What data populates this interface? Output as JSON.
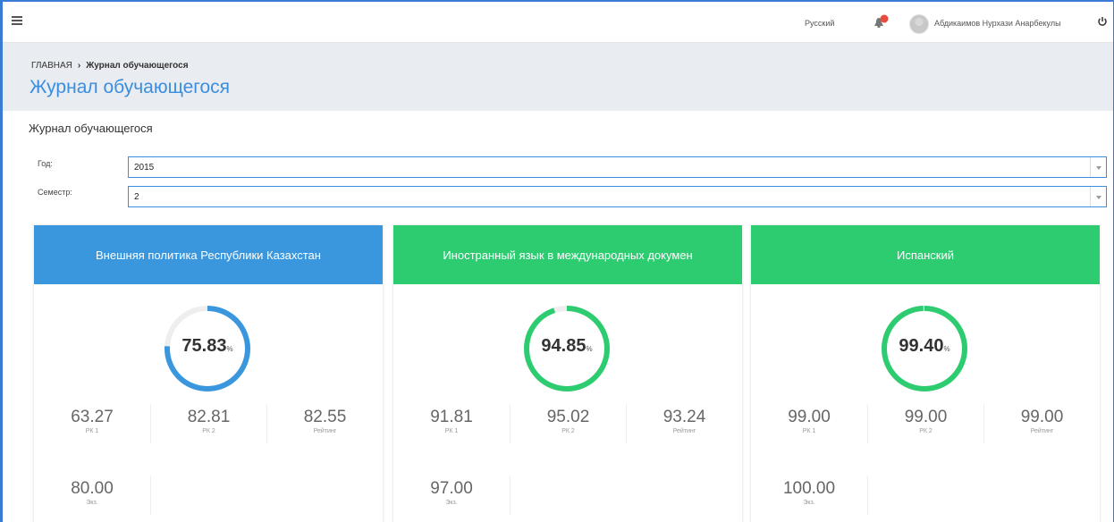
{
  "header": {
    "language": "Русский",
    "user_name": "Абдикаимов Нурхази Анарбекулы"
  },
  "breadcrumb": {
    "home": "ГЛАВНАЯ",
    "separator": "›",
    "current": "Журнал обучающегося"
  },
  "page_title": "Журнал обучающегося",
  "section_title": "Журнал обучающегося",
  "filters": {
    "year_label": "Год:",
    "year_value": "2015",
    "semester_label": "Семестр:",
    "semester_value": "2"
  },
  "colors": {
    "blue": "#3a97dd",
    "green": "#2ecc71"
  },
  "cards": [
    {
      "title": "Внешняя политика Республики Казахстан",
      "color": "blue",
      "score": "75.83",
      "score_fraction": 0.7583,
      "pct": "%",
      "rk1_value": "63.27",
      "rk1_label": "РК 1",
      "rk2_value": "82.81",
      "rk2_label": "РК 2",
      "rating_value": "82.55",
      "rating_label": "Рейтинг",
      "exam_value": "80.00",
      "exam_label": "Экз."
    },
    {
      "title": "Иностранный язык в международных докумен",
      "color": "green",
      "score": "94.85",
      "score_fraction": 0.9485,
      "pct": "%",
      "rk1_value": "91.81",
      "rk1_label": "РК 1",
      "rk2_value": "95.02",
      "rk2_label": "РК 2",
      "rating_value": "93.24",
      "rating_label": "Рейтинг",
      "exam_value": "97.00",
      "exam_label": "Экз."
    },
    {
      "title": "Испанский",
      "color": "green",
      "score": "99.40",
      "score_fraction": 0.994,
      "pct": "%",
      "rk1_value": "99.00",
      "rk1_label": "РК 1",
      "rk2_value": "99.00",
      "rk2_label": "РК 2",
      "rating_value": "99.00",
      "rating_label": "Рейтинг",
      "exam_value": "100.00",
      "exam_label": "Экз."
    }
  ]
}
